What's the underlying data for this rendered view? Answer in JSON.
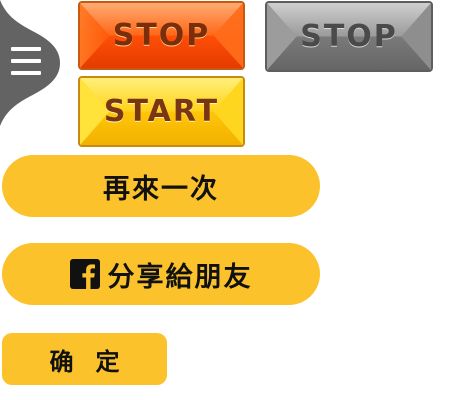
{
  "menu": {
    "icon": "hamburger-menu-icon",
    "tab_color": "#636363"
  },
  "arcade_buttons": {
    "stop_active": {
      "label": "STOP",
      "state": "active",
      "color": "#ff5a0a"
    },
    "stop_disabled": {
      "label": "STOP",
      "state": "disabled",
      "color": "#8a8a8a"
    },
    "start": {
      "label": "START",
      "state": "active",
      "color": "#ffd21a"
    }
  },
  "actions": {
    "retry_label": "再來一次",
    "share_label": "分享給朋友",
    "share_icon": "facebook-icon",
    "confirm_label": "确定"
  },
  "colors": {
    "pill_yellow": "#fbc22b",
    "text_dark": "#111111"
  }
}
